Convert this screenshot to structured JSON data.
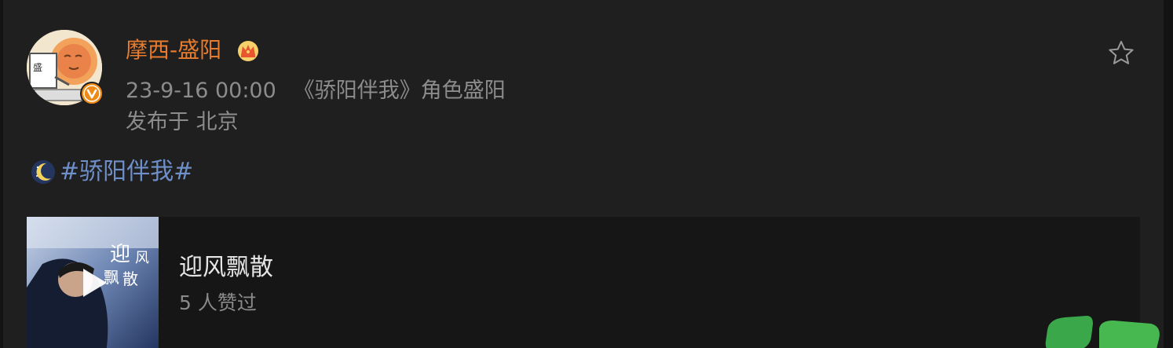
{
  "post": {
    "author": {
      "name": "摩西-盛阳",
      "verified": true,
      "badge_color": "#f08a16",
      "name_color": "#e77c2e"
    },
    "timestamp": "23-9-16 00:00",
    "role_text": "《骄阳伴我》角色盛阳",
    "location": "发布于 北京",
    "hashtag": "#骄阳伴我#",
    "hashtag_color": "#6f8fc9"
  },
  "music_card": {
    "title": "迎风飘散",
    "likes": "5 人赞过",
    "cover_text": "迎风飘散"
  },
  "icons": {
    "crown": "crown-icon",
    "star": "star-icon",
    "moon": "moon-icon",
    "play": "play-icon",
    "verify": "verified-v-icon"
  }
}
